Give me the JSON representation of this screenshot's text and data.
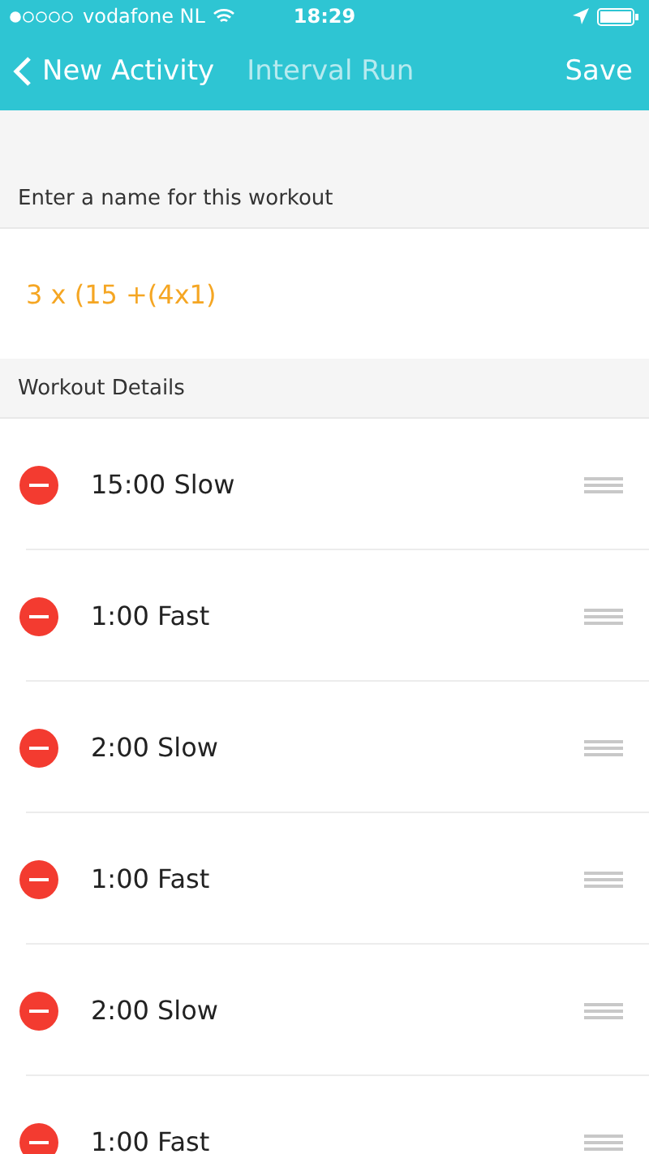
{
  "status_bar": {
    "carrier": "vodafone NL",
    "time": "18:29"
  },
  "nav": {
    "back_label": "New Activity",
    "title": "Interval Run",
    "action": "Save"
  },
  "name_section": {
    "label": "Enter a name for this workout",
    "value": "3 x (15 +(4x1)"
  },
  "details": {
    "label": "Workout Details",
    "rows": [
      {
        "text": "15:00 Slow"
      },
      {
        "text": "1:00 Fast"
      },
      {
        "text": "2:00 Slow"
      },
      {
        "text": "1:00 Fast"
      },
      {
        "text": "2:00 Slow"
      },
      {
        "text": "1:00 Fast"
      }
    ]
  }
}
